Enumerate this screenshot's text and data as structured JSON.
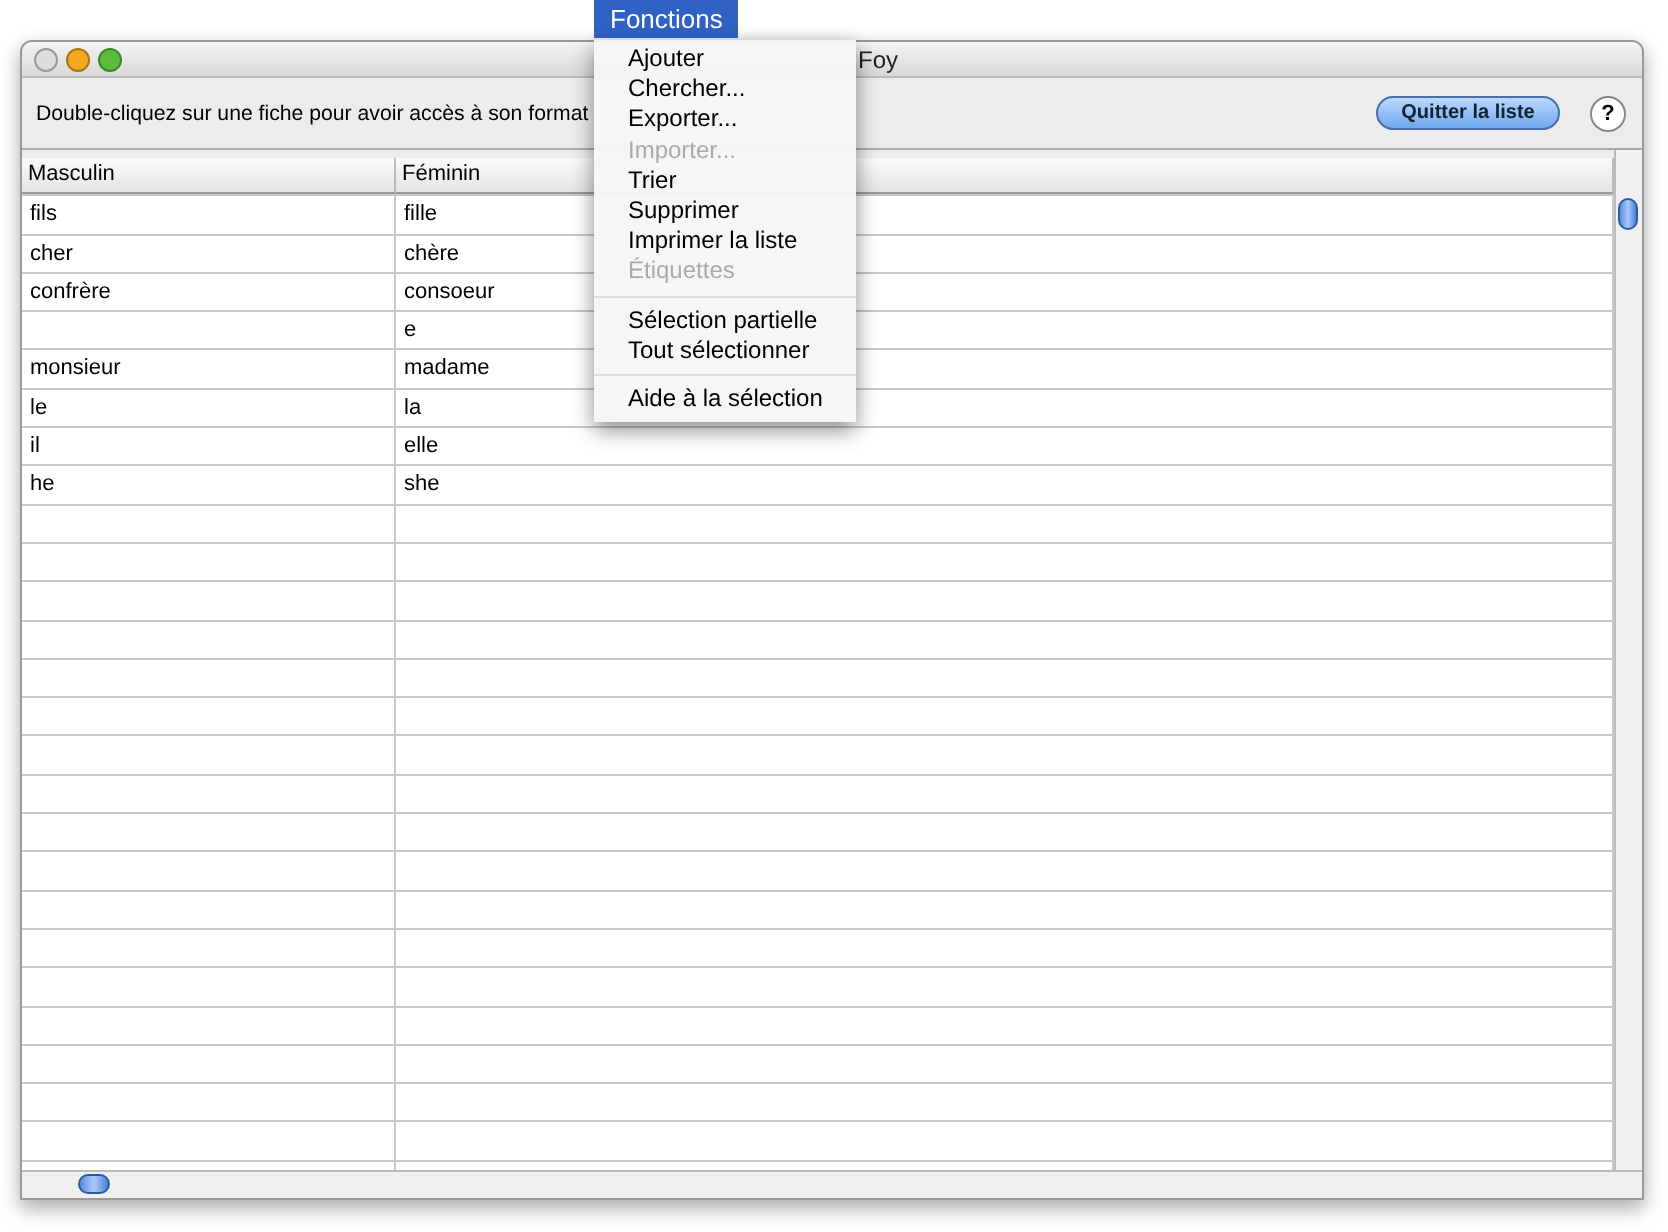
{
  "menu_bar": {
    "title": "Fonctions",
    "selected": true
  },
  "window": {
    "title": "Foy"
  },
  "toolbar": {
    "hint": "Double-cliquez sur une fiche pour avoir accès à son format",
    "quit_button": "Quitter la liste",
    "help_button": "?"
  },
  "table": {
    "columns": [
      "Masculin",
      "Féminin"
    ],
    "rows": [
      [
        "fils",
        "fille"
      ],
      [
        "cher",
        "chère"
      ],
      [
        "confrère",
        "consoeur"
      ],
      [
        "",
        "e"
      ],
      [
        "monsieur",
        "madame"
      ],
      [
        "le",
        "la"
      ],
      [
        "il",
        "elle"
      ],
      [
        "he",
        "she"
      ]
    ]
  },
  "menu": {
    "items": [
      {
        "kind": "item",
        "label": "Ajouter",
        "disabled": false
      },
      {
        "kind": "item",
        "label": "Chercher...",
        "disabled": false
      },
      {
        "kind": "item",
        "label": "Exporter...",
        "disabled": false
      },
      {
        "kind": "item",
        "label": "Importer...",
        "disabled": true
      },
      {
        "kind": "item",
        "label": "Trier",
        "disabled": false
      },
      {
        "kind": "item",
        "label": "Supprimer",
        "disabled": false
      },
      {
        "kind": "item",
        "label": "Imprimer la liste",
        "disabled": false
      },
      {
        "kind": "item",
        "label": "Étiquettes",
        "disabled": true
      },
      {
        "kind": "separator"
      },
      {
        "kind": "item",
        "label": "Sélection partielle",
        "disabled": false
      },
      {
        "kind": "item",
        "label": "Tout sélectionner",
        "disabled": false
      },
      {
        "kind": "separator"
      },
      {
        "kind": "item",
        "label": "Aide à la sélection",
        "disabled": false
      }
    ]
  }
}
